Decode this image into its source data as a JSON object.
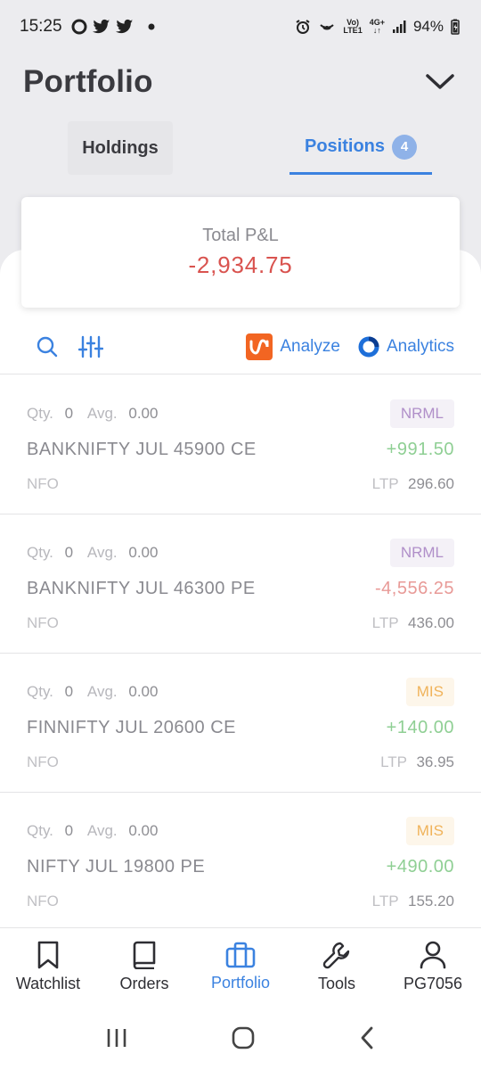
{
  "status_bar": {
    "time": "15:25",
    "battery": "94%",
    "network_top": "Vo)",
    "network_bottom": "LTE1",
    "net4g_top": "4G+",
    "net4g_bottom": "↓↑"
  },
  "header": {
    "title": "Portfolio"
  },
  "tabs": [
    {
      "label": "Holdings"
    },
    {
      "label": "Positions",
      "badge": "4"
    }
  ],
  "summary": {
    "label": "Total P&L",
    "value": "-2,934.75"
  },
  "toolbar": {
    "analyze_label": "Analyze",
    "analytics_label": "Analytics"
  },
  "labels": {
    "qty": "Qty.",
    "avg": "Avg.",
    "ltp": "LTP"
  },
  "positions": [
    {
      "qty": "0",
      "avg": "0.00",
      "product": "NRML",
      "symbol": "BANKNIFTY JUL 45900 CE",
      "pnl": "+991.50",
      "exchange": "NFO",
      "ltp": "296.60"
    },
    {
      "qty": "0",
      "avg": "0.00",
      "product": "NRML",
      "symbol": "BANKNIFTY JUL 46300 PE",
      "pnl": "-4,556.25",
      "exchange": "NFO",
      "ltp": "436.00"
    },
    {
      "qty": "0",
      "avg": "0.00",
      "product": "MIS",
      "symbol": "FINNIFTY JUL 20600 CE",
      "pnl": "+140.00",
      "exchange": "NFO",
      "ltp": "36.95"
    },
    {
      "qty": "0",
      "avg": "0.00",
      "product": "MIS",
      "symbol": "NIFTY JUL 19800 PE",
      "pnl": "+490.00",
      "exchange": "NFO",
      "ltp": "155.20"
    }
  ],
  "bottom_nav": [
    {
      "label": "Watchlist",
      "icon": "bookmark-icon"
    },
    {
      "label": "Orders",
      "icon": "book-icon"
    },
    {
      "label": "Portfolio",
      "icon": "briefcase-icon"
    },
    {
      "label": "Tools",
      "icon": "wrench-icon"
    },
    {
      "label": "PG7056",
      "icon": "user-icon"
    }
  ],
  "colors": {
    "accent": "#3b82e0",
    "loss": "#d9534f",
    "profit_soft": "#8fcf94",
    "loss_soft": "#e89a97",
    "analyze_brand": "#f26522"
  }
}
